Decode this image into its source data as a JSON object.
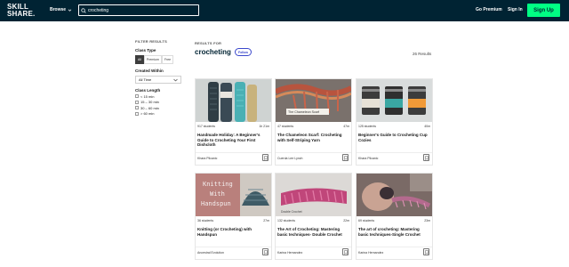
{
  "header": {
    "logo_line1": "SKILL",
    "logo_line2": "SHARE.",
    "browse_label": "Browse",
    "search_value": "crocheting",
    "premium_label": "Go Premium",
    "signin_label": "Sign In",
    "signup_label": "Sign Up"
  },
  "filters": {
    "title": "FILTER RESULTS",
    "class_type": {
      "label": "Class Type",
      "options": [
        "All",
        "Premium",
        "Free"
      ],
      "selected": "All"
    },
    "created_within": {
      "label": "Created Within",
      "value": "All Time"
    },
    "class_length": {
      "label": "Class Length",
      "options": [
        "< 15 min",
        "15 – 30 min",
        "30 – 60 min",
        "> 60 min"
      ]
    }
  },
  "results": {
    "label": "RESULTS FOR",
    "query": "crocheting",
    "follow_label": "Follow",
    "count": "26 Results"
  },
  "cards": [
    {
      "students": "917 students",
      "duration": "1h 21m",
      "title": "Handmade Holiday: A Beginner's Guide to Crocheting Your First Dishcloth",
      "author": "Khara Plicanic"
    },
    {
      "students": "47 students",
      "duration": "47m",
      "title": "The Chameleon Scarf: Crocheting with Self-Striping Yarn",
      "author": "Cuerda Lee Lynch",
      "thumb_text": "The Chameleon Scarf"
    },
    {
      "students": "125 students",
      "duration": "40m",
      "title": "Beginner's Guide to Crocheting Cup Cozies",
      "author": "Khara Plicanic"
    },
    {
      "students": "36 students",
      "duration": "27m",
      "title": "Knitting (or Crocheting) with Handspun",
      "author": "Ancestral Evolution",
      "thumb_text_1": "Knitting",
      "thumb_text_2": "With",
      "thumb_text_3": "Handspun"
    },
    {
      "students": "132 students",
      "duration": "22m",
      "title": "The Art of Crocheting: Mastering basic techniques- Double Crochet",
      "author": "Karina Hernandez",
      "thumb_text": "Double Crochet"
    },
    {
      "students": "69 students",
      "duration": "23m",
      "title": "The art of crocheting: Mastering basic techniques-Single Crochet",
      "author": "Karina Hernandez"
    }
  ],
  "colors": {
    "topbar": "#002333",
    "accent_green": "#00ff84",
    "follow_blue": "#3b48cc"
  }
}
